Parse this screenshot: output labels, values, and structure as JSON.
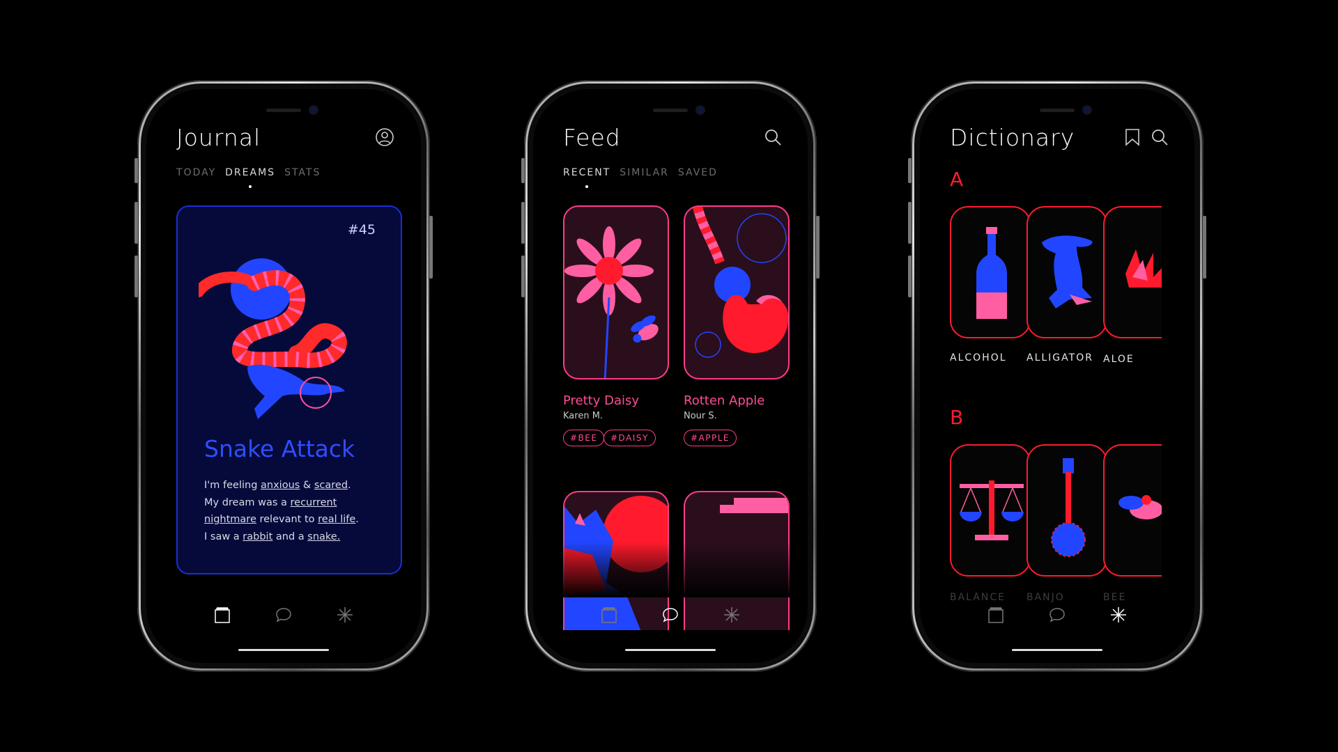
{
  "colors": {
    "journal_accent": "#2f4dff",
    "feed_accent": "#ff3c8a",
    "dictionary_accent": "#ff1b2d"
  },
  "journal": {
    "title": "Journal",
    "profile_icon": "profile-icon",
    "tabs": [
      {
        "label": "TODAY"
      },
      {
        "label": "DREAMS"
      },
      {
        "label": "STATS"
      }
    ],
    "active_tab": "DREAMS",
    "card": {
      "number": "#45",
      "title": "Snake Attack",
      "text": {
        "l1a": "I'm feeling ",
        "l1b": "anxious",
        "l1c": " & ",
        "l1d": "scared",
        "l1e": ".",
        "l2a": "My dream was a ",
        "l2b": "recurrent",
        "l3a": "nightmare",
        "l3b": " relevant to ",
        "l3c": "real life",
        "l3d": ".",
        "l4a": "I saw a ",
        "l4b": "rabbit",
        "l4c": " and a ",
        "l4d": "snake."
      }
    }
  },
  "feed": {
    "title": "Feed",
    "search_icon": "search-icon",
    "tabs": [
      {
        "label": "RECENT"
      },
      {
        "label": "SIMILAR"
      },
      {
        "label": "SAVED"
      }
    ],
    "active_tab": "RECENT",
    "posts": [
      {
        "title": "Pretty Daisy",
        "author": "Karen M.",
        "tags": [
          "#BEE",
          "#DAISY"
        ]
      },
      {
        "title": "Rotten Apple",
        "author": "Nour S.",
        "tags": [
          "#APPLE"
        ]
      }
    ]
  },
  "dictionary": {
    "title": "Dictionary",
    "sections": [
      {
        "letter": "A",
        "items": [
          "ALCOHOL",
          "ALLIGATOR",
          "ALOE"
        ]
      },
      {
        "letter": "B",
        "items": [
          "BALANCE",
          "BANJO",
          "BEE"
        ]
      }
    ]
  },
  "bottom_nav": [
    "journal-icon",
    "chat-bubble-icon",
    "sparkle-icon"
  ]
}
